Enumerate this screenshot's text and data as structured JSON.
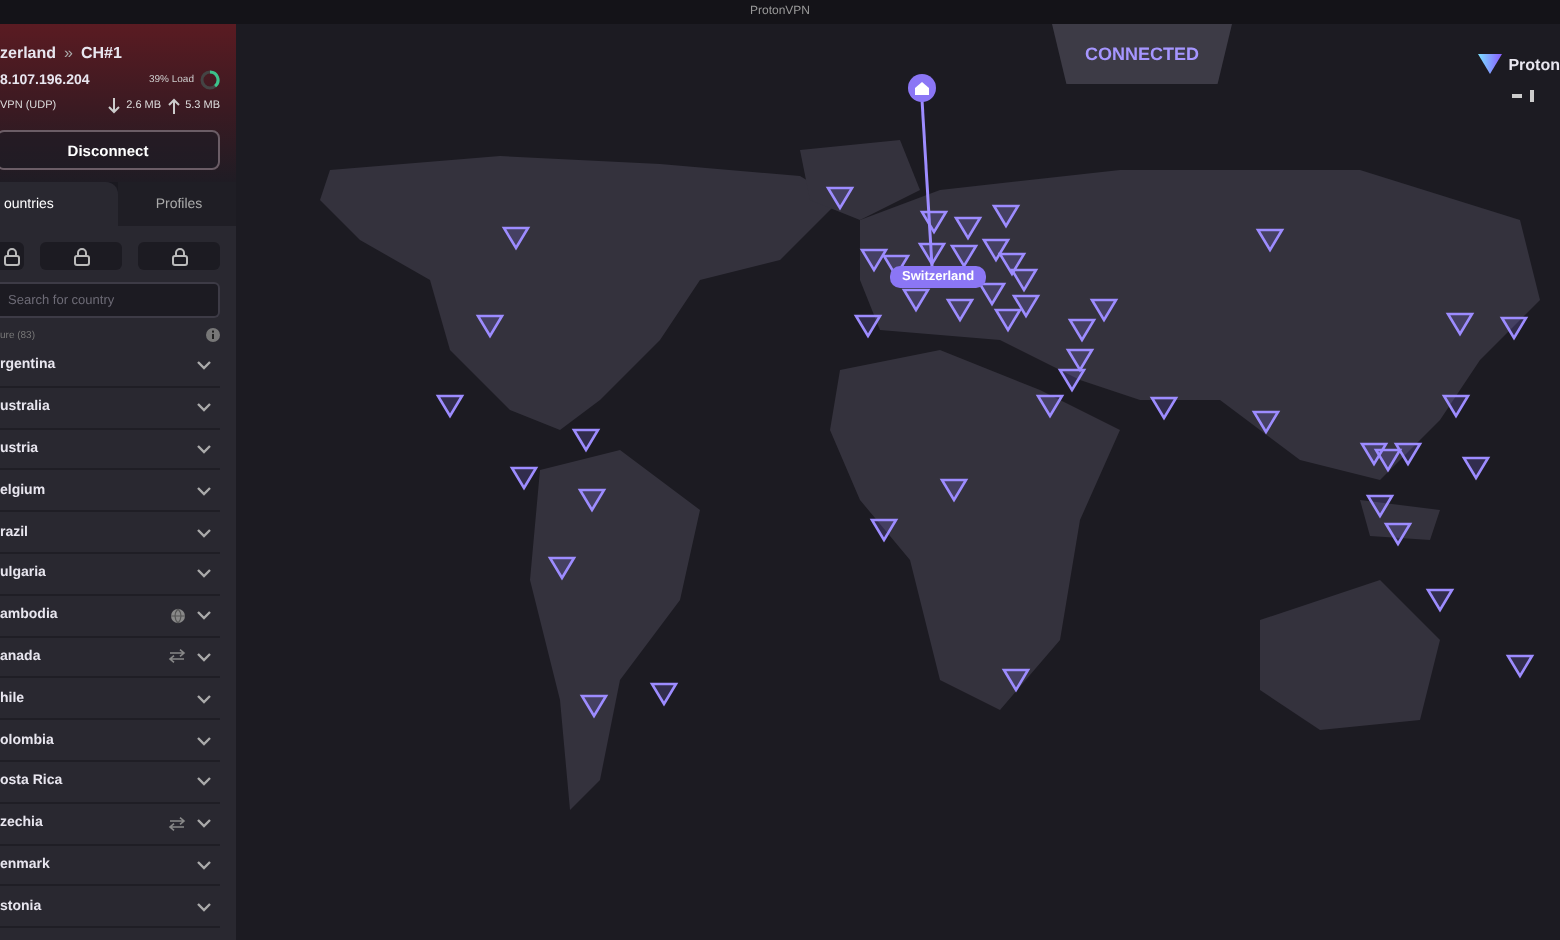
{
  "window": {
    "title": "ProtonVPN"
  },
  "connection": {
    "server": "zerland",
    "server_code": "CH#1",
    "separator": "»",
    "ip": "8.107.196.204",
    "protocol": "VPN (UDP)",
    "load_text": "39% Load",
    "load": {
      "level": 0.39
    },
    "download": "2.6 MB",
    "upload": "5.3 MB"
  },
  "disconnect_button": "Disconnect",
  "tabs": [
    {
      "label": "ountries",
      "selected": true
    },
    {
      "label": "Profiles",
      "selected": false
    }
  ],
  "search": {
    "placeholder": "Search for country"
  },
  "list_header": "ure (83)",
  "countries": [
    {
      "name": "rgentina",
      "kind": "plain"
    },
    {
      "name": "ustralia",
      "kind": "plain"
    },
    {
      "name": "ustria",
      "kind": "plain"
    },
    {
      "name": "elgium",
      "kind": "plain"
    },
    {
      "name": "razil",
      "kind": "plain"
    },
    {
      "name": "ulgaria",
      "kind": "plain"
    },
    {
      "name": "ambodia",
      "kind": "globe"
    },
    {
      "name": "anada",
      "kind": "swap"
    },
    {
      "name": "hile",
      "kind": "plain"
    },
    {
      "name": "olombia",
      "kind": "plain"
    },
    {
      "name": "osta Rica",
      "kind": "plain"
    },
    {
      "name": "zechia",
      "kind": "swap"
    },
    {
      "name": "enmark",
      "kind": "plain"
    },
    {
      "name": "stonia",
      "kind": "plain"
    }
  ],
  "map": {
    "status": "CONNECTED",
    "connected_country": "Switzerland"
  },
  "brand": "Proton"
}
